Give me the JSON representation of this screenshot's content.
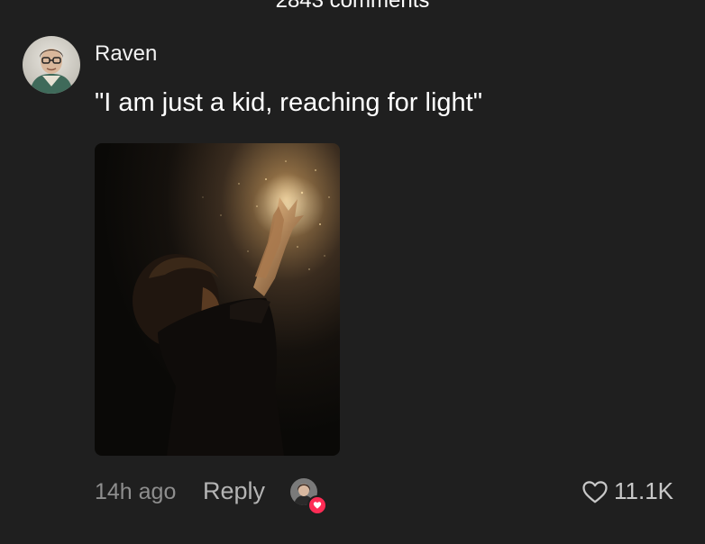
{
  "header": {
    "comment_count": "2843 comments"
  },
  "comment": {
    "username": "Raven",
    "text": "\"I am just a kid, reaching for light\"",
    "timestamp": "14h ago",
    "reply_label": "Reply",
    "like_count": "11.1K"
  },
  "icons": {
    "like": "heart-outline-icon",
    "creator_liked": "heart-badge-icon"
  },
  "colors": {
    "background": "#1f1f1f",
    "accent": "#fe2c55",
    "muted_text": "#8e8e8e"
  }
}
